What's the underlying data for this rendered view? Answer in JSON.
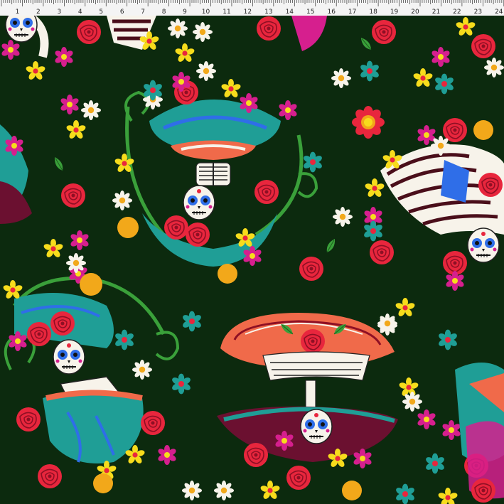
{
  "ruler": {
    "labels": [
      "1",
      "2",
      "3",
      "4",
      "5",
      "6",
      "7",
      "8",
      "9",
      "10",
      "11",
      "12",
      "13",
      "14",
      "15",
      "16",
      "17",
      "18",
      "19",
      "20",
      "21",
      "22",
      "23",
      "24"
    ]
  },
  "colors": {
    "background": "#0c2a0e",
    "rose": "#e8263d",
    "teal": "#1f9e96",
    "coral": "#f06a4a",
    "orange": "#f29018",
    "yellow": "#f7dc1c",
    "magenta": "#d61f8e",
    "maroon": "#6b1030",
    "white": "#f7f3ea",
    "leaf": "#3aa03a",
    "blue": "#2f6ee8"
  },
  "motifs": [
    "sugar-skull-catrina",
    "skeleton-figure",
    "sombrero-hat",
    "red-rose",
    "daisy",
    "small-flower",
    "green-leaf",
    "swirl-vine"
  ]
}
